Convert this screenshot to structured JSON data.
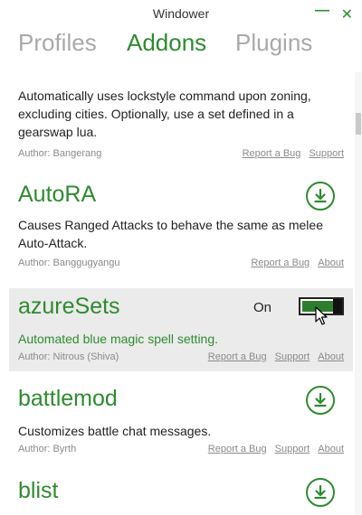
{
  "window": {
    "title": "Windower",
    "minimize_label": "—",
    "close_label": "✕"
  },
  "tabs": [
    {
      "label": "Profiles",
      "active": false
    },
    {
      "label": "Addons",
      "active": true
    },
    {
      "label": "Plugins",
      "active": false
    }
  ],
  "addons": [
    {
      "name": "",
      "description": "Automatically uses lockstyle command upon zoning, excluding cities. Optionally, use a set defined in a gearswap lua.",
      "author": "Author: Bangerang",
      "links": [
        "Report a Bug",
        "Support"
      ]
    },
    {
      "name": "AutoRA",
      "description": "Causes Ranged Attacks to behave the same as melee Auto-Attack.",
      "author": "Author: Banggugyangu",
      "links": [
        "Report a Bug",
        "About"
      ],
      "action_icon": "download-icon"
    },
    {
      "name": "azureSets",
      "description": "Automated blue magic spell setting.",
      "author": "Author: Nitrous (Shiva)",
      "links": [
        "Report a Bug",
        "Support",
        "About"
      ],
      "toggle_label": "On",
      "toggle_state": "on"
    },
    {
      "name": "battlemod",
      "description": "Customizes battle chat messages.",
      "author": "Author: Byrth",
      "links": [
        "Report a Bug",
        "Support",
        "About"
      ],
      "action_icon": "download-icon"
    },
    {
      "name": "blist",
      "action_icon": "download-icon"
    }
  ],
  "colors": {
    "accent": "#2e8b2e",
    "inactive_tab": "#a9a9a9",
    "selected_bg": "#ebebeb",
    "muted_text": "#8a8a8a"
  }
}
